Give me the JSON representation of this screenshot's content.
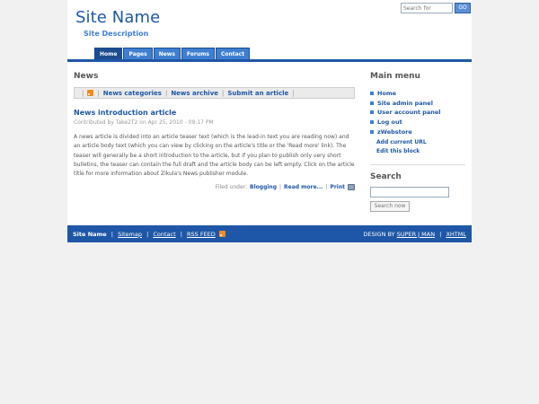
{
  "header": {
    "site_name": "Site Name",
    "site_description": "Site Description",
    "search_placeholder": "Search for",
    "search_button": "GO"
  },
  "nav": {
    "tabs": [
      "Home",
      "Pages",
      "News",
      "Forums",
      "Contact"
    ]
  },
  "main": {
    "section_title": "News",
    "bar_links": [
      "News categories",
      "News archive",
      "Submit an article"
    ],
    "article": {
      "title": "News introduction article",
      "meta": "Contributed by Take2T2 on Apr 25, 2010 - 09:17 PM",
      "body": "A news article is divided into an article teaser text (which is the lead-in text you are reading now) and an article body text (which you can view by clicking on the article's title or the 'Read more' link). The teaser will generally be a short introduction to the article, but if you plan to publish only very short bulletins, the teaser can contain the full draft and the article body can be left empty. Click on the article title for more information about Zikula's News publisher module.",
      "filed_under": "Filed under:",
      "category": "Blogging",
      "read_more": "Read more...",
      "print": "Print"
    }
  },
  "sidebar": {
    "main_menu_title": "Main menu",
    "menu_items": [
      "Home",
      "Site admin panel",
      "User account panel",
      "Log out",
      "zWebstore"
    ],
    "add_current_url": "Add current URL",
    "edit_block": "Edit this block",
    "search_title": "Search",
    "search_button": "Search now"
  },
  "footer": {
    "links": [
      "Site Name",
      "Sitemap",
      "Contact",
      "RSS FEED"
    ],
    "design_by": "DESIGN BY",
    "designer": "SUPER J MAN",
    "xhtml": "XHTML"
  },
  "colors": {
    "accent": "#1e57a7",
    "nav_tab": "#3f7fd1",
    "background": "#f1f1f1",
    "rss": "#f58a1f"
  }
}
